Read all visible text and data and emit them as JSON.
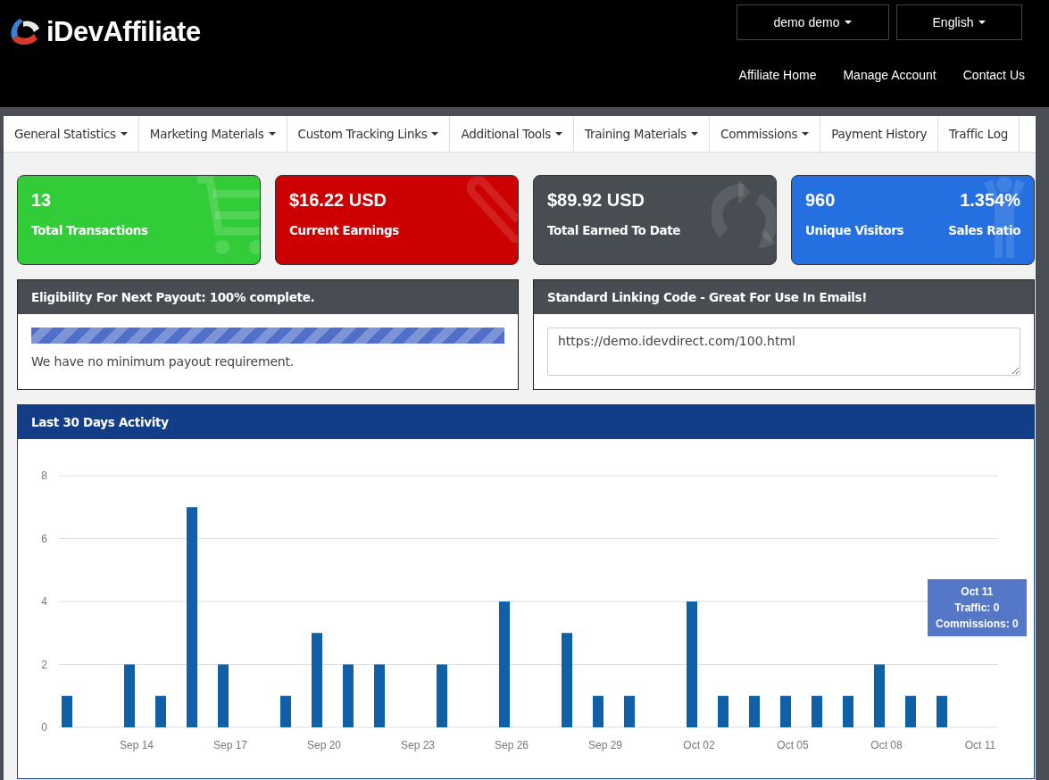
{
  "header": {
    "logo_text": "iDevAffiliate",
    "menus": [
      {
        "label": "demo demo",
        "has_menu": true
      },
      {
        "label": "English",
        "has_menu": true
      }
    ],
    "links": [
      "Affiliate Home",
      "Manage Account",
      "Contact Us"
    ]
  },
  "nav": [
    {
      "label": "General Statistics",
      "has_menu": true
    },
    {
      "label": "Marketing Materials",
      "has_menu": true
    },
    {
      "label": "Custom Tracking Links",
      "has_menu": true
    },
    {
      "label": "Additional Tools",
      "has_menu": true
    },
    {
      "label": "Training Materials",
      "has_menu": true
    },
    {
      "label": "Commissions",
      "has_menu": true
    },
    {
      "label": "Payment History",
      "has_menu": false
    },
    {
      "label": "Traffic Log",
      "has_menu": false
    }
  ],
  "cards": [
    {
      "kind": "cart",
      "stats": [
        {
          "value": "13",
          "label": "Total Transactions"
        }
      ]
    },
    {
      "kind": "paperclip",
      "stats": [
        {
          "value": "$16.22 USD",
          "label": "Current Earnings"
        }
      ]
    },
    {
      "kind": "refresh",
      "stats": [
        {
          "value": "$89.92 USD",
          "label": "Total Earned To Date"
        }
      ]
    },
    {
      "kind": "person",
      "stats": [
        {
          "value": "960",
          "label": "Unique Visitors"
        },
        {
          "value": "1.354%",
          "label": "Sales Ratio"
        }
      ]
    }
  ],
  "payout": {
    "title": "Eligibility For Next Payout: 100% complete.",
    "level": 1.0,
    "note": "We have no minimum payout requirement."
  },
  "linking": {
    "title": "Standard Linking Code - Great For Use In Emails!",
    "value": "https://demo.idevdirect.com/100.html"
  },
  "activity": {
    "title": "Last 30 Days Activity",
    "chart_data": {
      "type": "bar",
      "categories": [
        null,
        null,
        "Sep 14",
        null,
        null,
        "Sep 17",
        null,
        null,
        "Sep 20",
        null,
        null,
        "Sep 23",
        null,
        null,
        "Sep 26",
        null,
        null,
        "Sep 29",
        null,
        null,
        "Oct 02",
        null,
        null,
        "Oct 05",
        null,
        null,
        "Oct 08",
        null,
        null,
        "Oct 11"
      ],
      "grid": true,
      "series": [
        {
          "color": "#1060a8",
          "values": [
            1,
            0,
            2,
            1,
            7,
            2,
            0,
            1,
            3,
            2,
            2,
            0,
            2,
            0,
            4,
            0,
            3,
            1,
            1,
            0,
            4,
            1,
            1,
            1,
            1,
            1,
            2,
            1,
            1,
            0
          ]
        }
      ],
      "ylim": [
        0,
        8
      ],
      "yticks": [
        0,
        2,
        4,
        6,
        8
      ]
    },
    "tooltip": {
      "title": "Oct 11",
      "lines": [
        "Traffic: 0",
        "Commissions: 0"
      ]
    }
  }
}
